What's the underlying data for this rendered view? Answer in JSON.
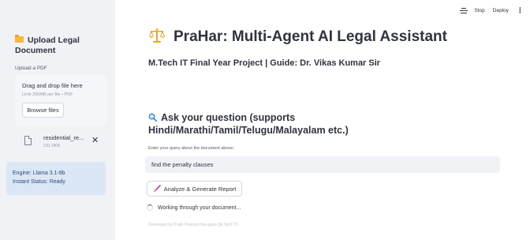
{
  "sidebar": {
    "title": "Upload Legal Document",
    "upload_label": "Upload a PDF",
    "dropzone_text": "Drag and drop file here",
    "dropzone_limit": "Limit 200MB per file • PDF",
    "browse_button": "Browse files",
    "file": {
      "name": "residential_re...",
      "size": "231.0KB"
    },
    "info_engine": "Engine: Llama 3.1-8b",
    "info_status": "Instant Status: Ready"
  },
  "toolbar": {
    "stop_label": "Stop",
    "deploy_label": "Deploy",
    "menu_glyph": "⋮"
  },
  "main": {
    "title": "PraHar: Multi-Agent AI Legal Assistant",
    "subtitle": "M.Tech IT Final Year Project | Guide: Dr. Vikas Kumar Sir",
    "ask_heading": "Ask your question (supports Hindi/Marathi/Tamil/Telugu/Malayalam etc.)",
    "input_label": "Enter your query about the document above:",
    "query_value": "find the penalty clauses",
    "analyze_button": "Analyze & Generate Report",
    "working_text": "Working through your document...",
    "footer": "Developed by Pratik Pramod Harugade (M.Tech IT)"
  },
  "icons": {
    "folder": "folder-icon",
    "file": "file-icon",
    "close": "close-icon",
    "scale": "scale-icon",
    "search": "search-icon",
    "brush": "brush-icon",
    "running": "running-man-icon"
  },
  "colors": {
    "sidebar_bg": "#f0f2f6",
    "info_bg": "#dce7f5",
    "input_bg": "#f0f2f6",
    "text": "#31333f",
    "accent_gold": "#e8a52a"
  }
}
